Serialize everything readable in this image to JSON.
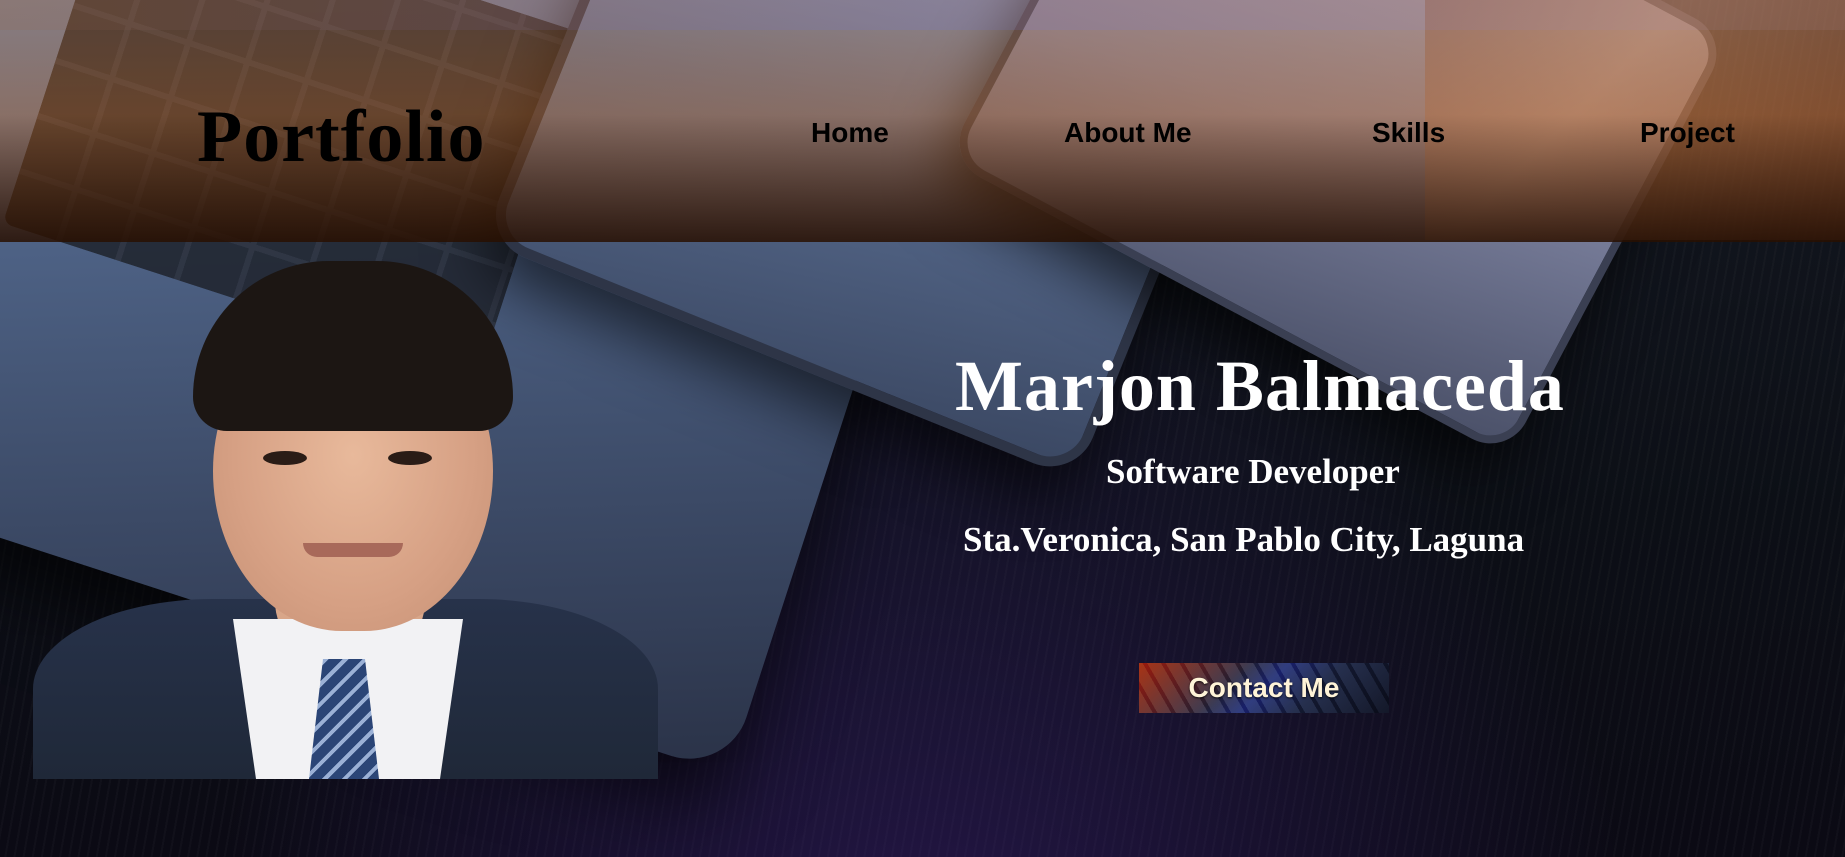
{
  "header": {
    "logo": "Portfolio",
    "nav": [
      {
        "label": "Home"
      },
      {
        "label": "About Me"
      },
      {
        "label": "Skills"
      },
      {
        "label": "Project"
      }
    ]
  },
  "hero": {
    "name": "Marjon Balmaceda",
    "role": "Software Developer",
    "location": "Sta.Veronica, San Pablo City, Laguna",
    "contact_button": "Contact Me"
  },
  "colors": {
    "header_tint": "#e6781e",
    "text_dark": "#000000",
    "text_light": "#ffffff",
    "button_text": "#fff4d8"
  }
}
